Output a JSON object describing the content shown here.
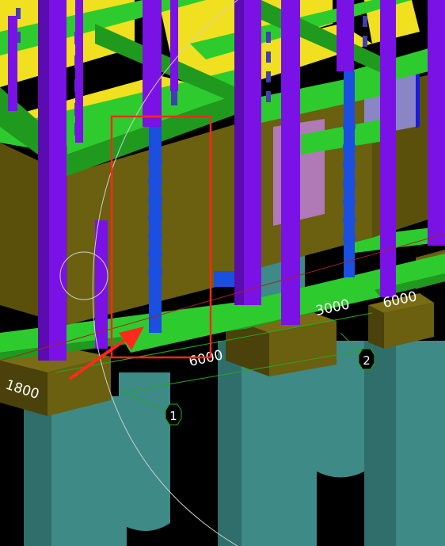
{
  "viewport": {
    "background": "#000000",
    "colors": {
      "pile": "#3d8a86",
      "pile_shade": "#2f6e6b",
      "pile_cap": "#6b5f10",
      "pile_cap_dark": "#4a420a",
      "beam": "#2ecb2e",
      "beam_dark": "#1f9a1f",
      "column": "#7a12e6",
      "column_dark": "#5a0cb0",
      "wall": "#6b5f10",
      "wall_dark": "#5a500c",
      "slab": "#f0e020",
      "rebar": "#1a4fe0",
      "opening": "#b07ab6",
      "grid_line": "#22aa22",
      "axis_line": "#aa2222",
      "highlight": "#ff2a1a"
    }
  },
  "dimensions": [
    {
      "name": "dim-1800",
      "text": "1800"
    },
    {
      "name": "dim-6000",
      "text": "6000"
    },
    {
      "name": "dim-3000",
      "text": "3000"
    },
    {
      "name": "dim-6000-right",
      "text": "6000"
    }
  ],
  "grid_axes": [
    {
      "name": "axis-1",
      "label": "1"
    },
    {
      "name": "axis-2",
      "label": "2"
    }
  ],
  "annotation": {
    "highlight_box": "selected rebar region",
    "arrow": "pointer arrow"
  }
}
